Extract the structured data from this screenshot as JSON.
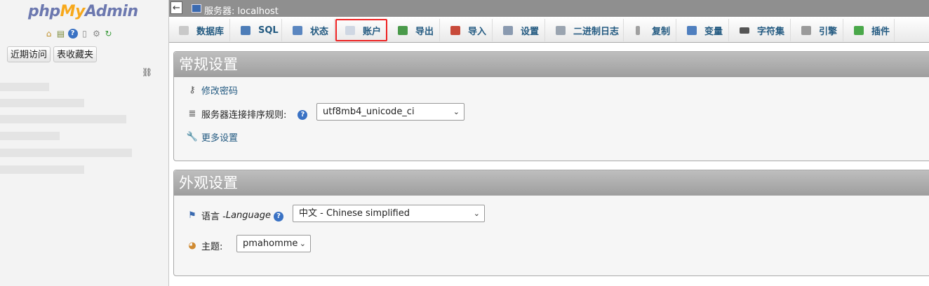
{
  "logo": {
    "php": "php",
    "my": "My",
    "admin": "Admin"
  },
  "nav_icons": [
    "home-icon",
    "logout-icon",
    "help-icon",
    "docs-icon",
    "settings-icon",
    "reload-icon"
  ],
  "nav_buttons": {
    "recent": "近期访问",
    "favorites": "表收藏夹"
  },
  "topbar": {
    "server_label": "服务器: localhost",
    "collapse": "←"
  },
  "tabs": [
    {
      "label": "数据库",
      "icon": "database-icon",
      "color": "#c9c9c9"
    },
    {
      "label": "SQL",
      "icon": "sql-icon",
      "color": "#4d7db8"
    },
    {
      "label": "状态",
      "icon": "status-icon",
      "color": "#5a86c0"
    },
    {
      "label": "账户",
      "icon": "accounts-icon",
      "color": "#cfd7e3",
      "active": true
    },
    {
      "label": "导出",
      "icon": "export-icon",
      "color": "#4a9a4a"
    },
    {
      "label": "导入",
      "icon": "import-icon",
      "color": "#c84a3a"
    },
    {
      "label": "设置",
      "icon": "wrench-icon",
      "color": "#8a9ab0"
    },
    {
      "label": "二进制日志",
      "icon": "binlog-icon",
      "color": "#9aa4b0"
    },
    {
      "label": "复制",
      "icon": "replication-icon",
      "color": "#a0a0a0"
    },
    {
      "label": "变量",
      "icon": "variables-icon",
      "color": "#4f7fbf"
    },
    {
      "label": "字符集",
      "icon": "charset-icon",
      "color": "#555555"
    },
    {
      "label": "引擎",
      "icon": "engine-icon",
      "color": "#9a9a9a"
    },
    {
      "label": "插件",
      "icon": "plugin-icon",
      "color": "#4aa84a"
    }
  ],
  "general": {
    "title": "常规设置",
    "change_password": "修改密码",
    "collation_label": "服务器连接排序规则:",
    "collation_value": "utf8mb4_unicode_ci",
    "more_settings": "更多设置"
  },
  "appearance": {
    "title": "外观设置",
    "language_label": "语言 - ",
    "language_label_en": "Language",
    "language_value": "中文 - Chinese simplified",
    "theme_label": "主题:",
    "theme_value": "pmahomme"
  }
}
